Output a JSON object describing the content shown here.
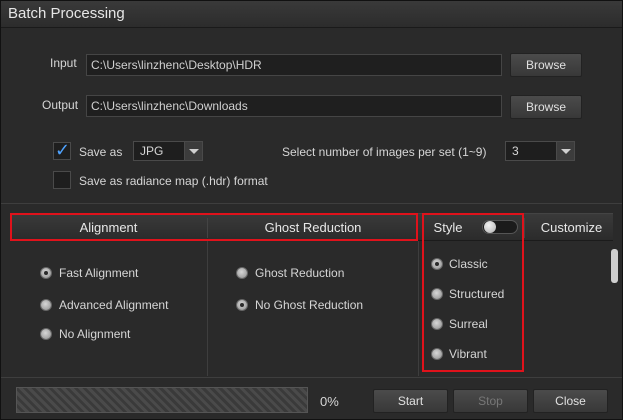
{
  "window": {
    "title": "Batch Processing"
  },
  "io": {
    "input_label": "Input",
    "input_value": "C:\\Users\\linzhenc\\Desktop\\HDR",
    "output_label": "Output",
    "output_value": "C:\\Users\\linzhenc\\Downloads",
    "browse_label": "Browse"
  },
  "options": {
    "save_as_label": "Save as",
    "save_as_checked": true,
    "format_value": "JPG",
    "images_per_set_label": "Select number of images per set (1~9)",
    "images_per_set_value": "3",
    "radiance_label": "Save as radiance map (.hdr) format",
    "radiance_checked": false
  },
  "tabs": {
    "alignment": "Alignment",
    "ghost_reduction": "Ghost Reduction",
    "style": "Style",
    "customize": "Customize"
  },
  "alignment_options": [
    {
      "label": "Fast Alignment",
      "selected": true
    },
    {
      "label": "Advanced Alignment",
      "selected": false
    },
    {
      "label": "No Alignment",
      "selected": false
    }
  ],
  "ghost_options": [
    {
      "label": "Ghost Reduction",
      "selected": false
    },
    {
      "label": "No Ghost Reduction",
      "selected": true
    }
  ],
  "style_options": [
    {
      "label": "Classic",
      "selected": true
    },
    {
      "label": "Structured",
      "selected": false
    },
    {
      "label": "Surreal",
      "selected": false
    },
    {
      "label": "Vibrant",
      "selected": false
    }
  ],
  "progress": {
    "percent": 0,
    "percent_label": "0%"
  },
  "footer": {
    "start": "Start",
    "stop": "Stop",
    "close": "Close"
  },
  "colors": {
    "highlight": "#e0121b",
    "accent": "#4fa3ff"
  }
}
